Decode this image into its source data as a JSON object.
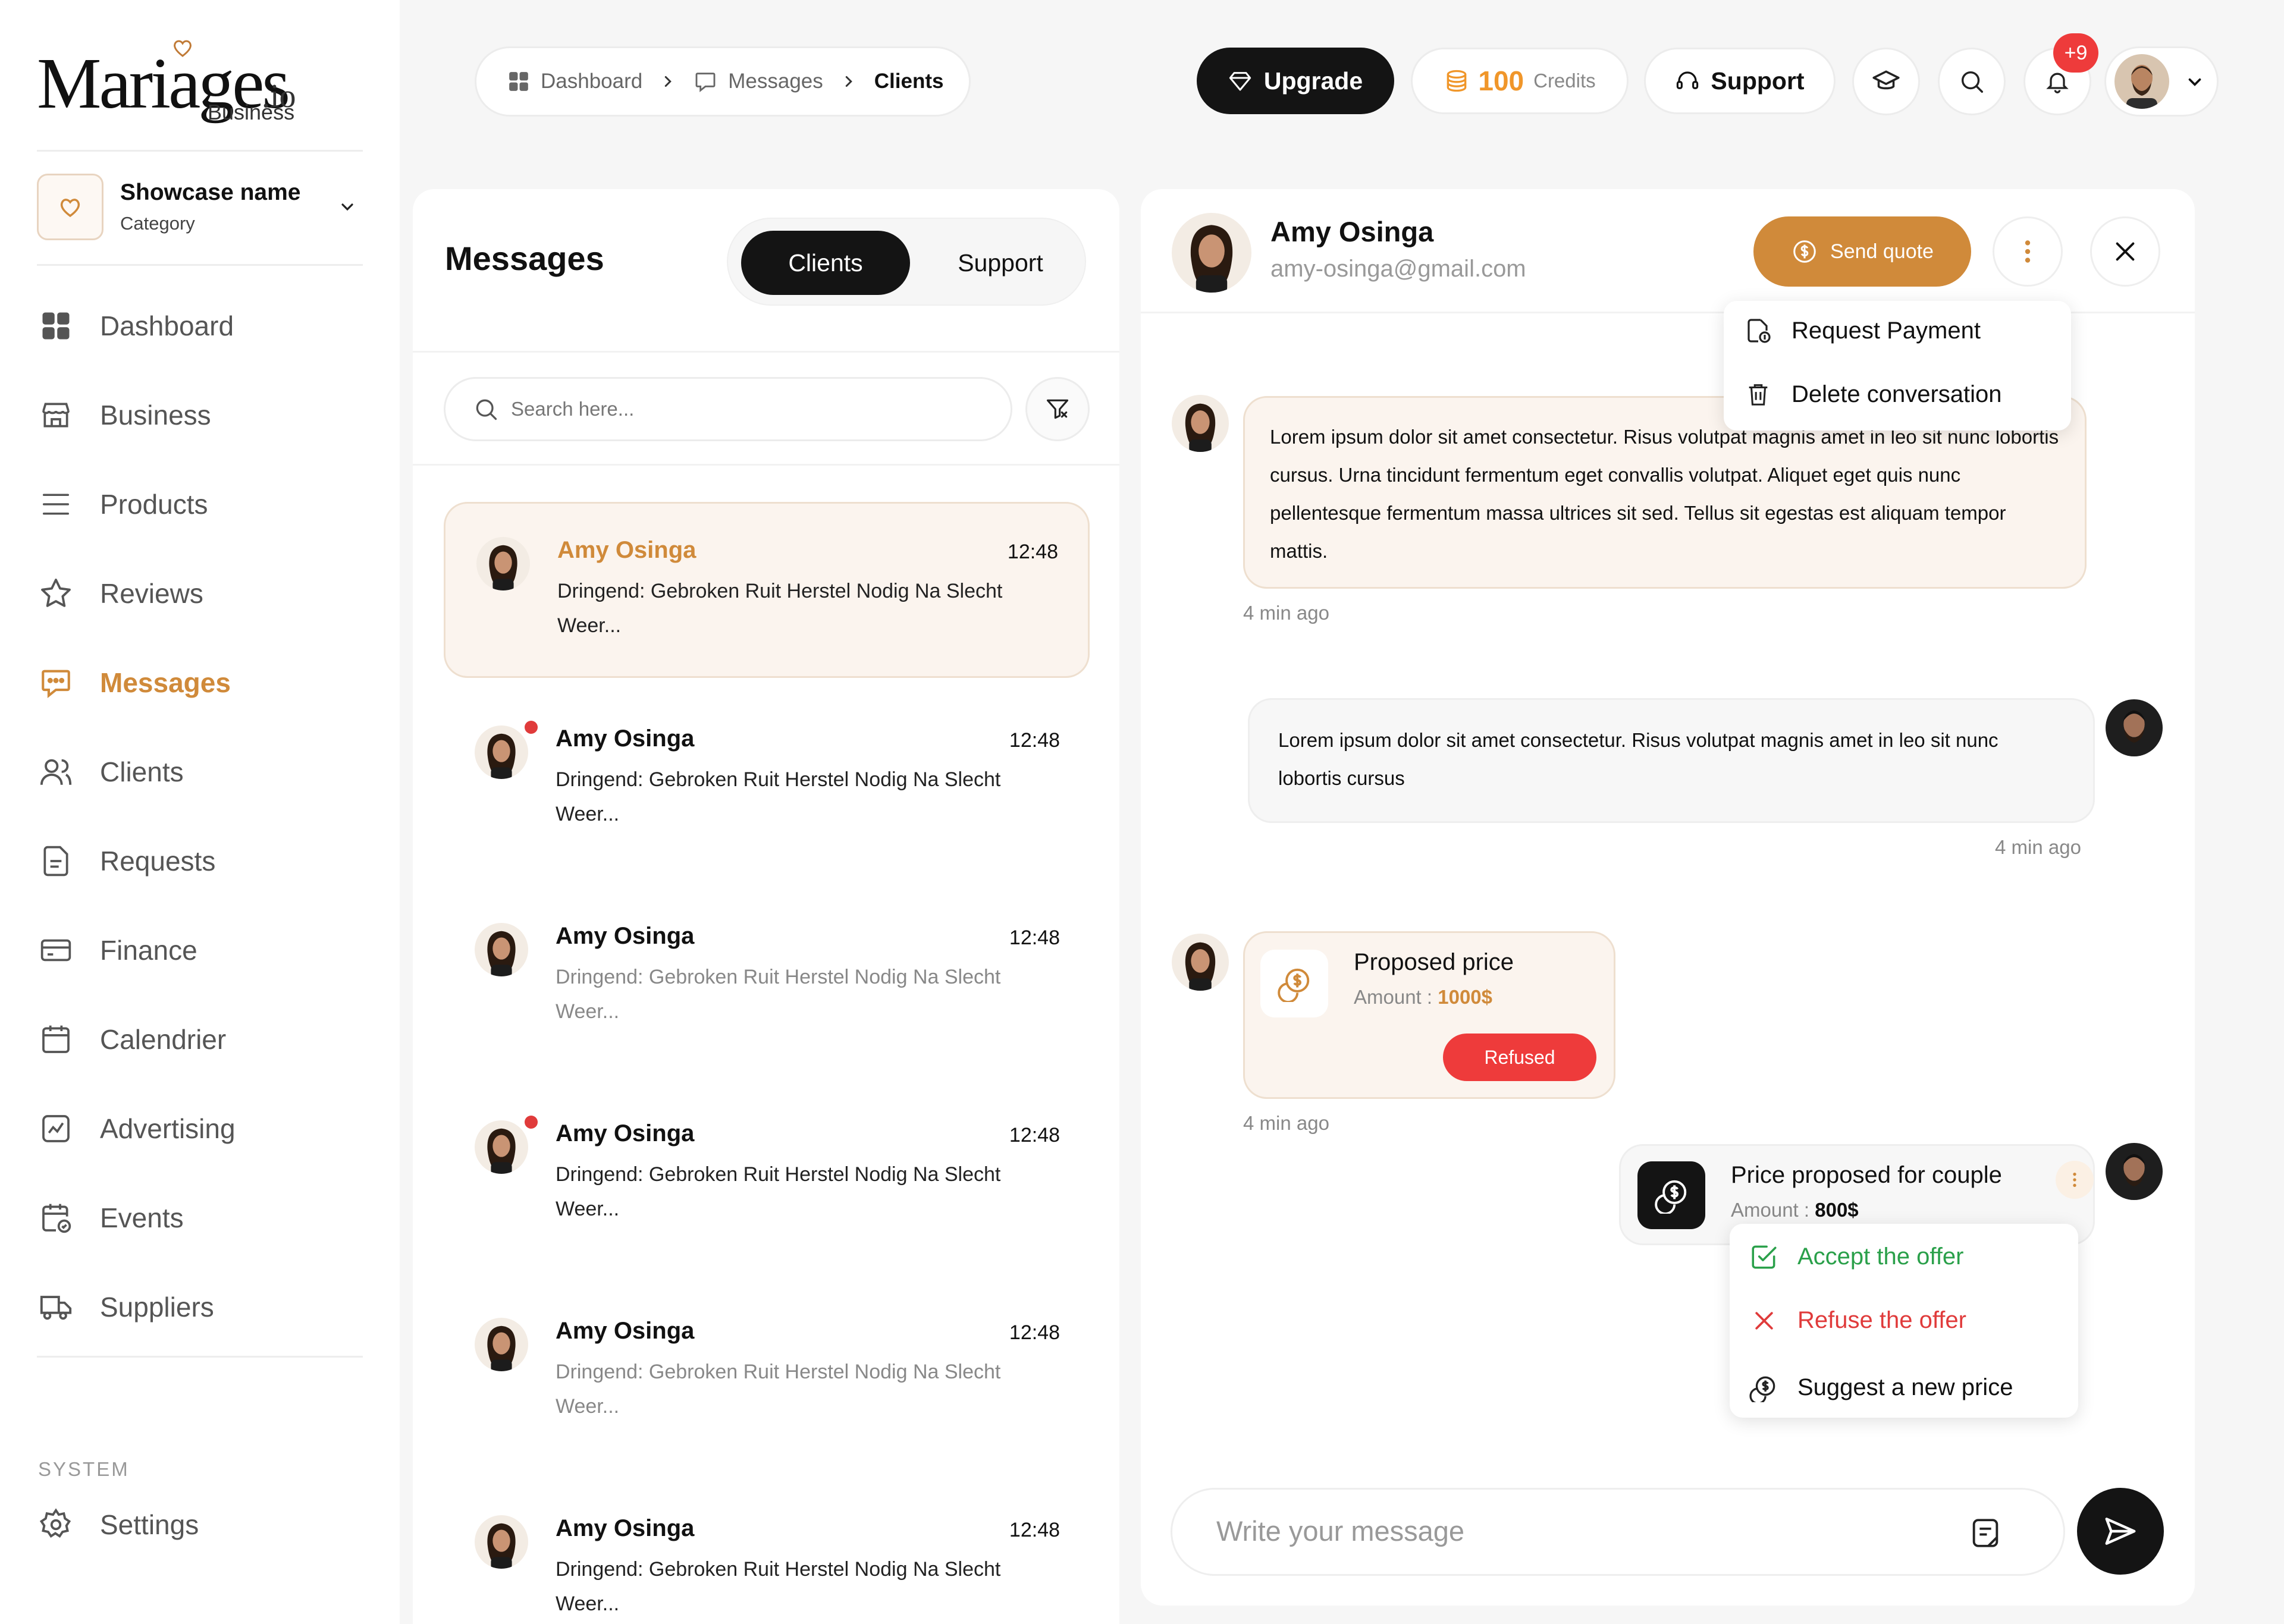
{
  "brand": {
    "name": "Mariages",
    "suffix": ".io",
    "sub": "Business"
  },
  "showcase": {
    "name": "Showcase name",
    "category": "Category"
  },
  "nav": {
    "items": [
      {
        "label": "Dashboard",
        "icon": "dashboard-icon"
      },
      {
        "label": "Business",
        "icon": "store-icon"
      },
      {
        "label": "Products",
        "icon": "menu-lines-icon"
      },
      {
        "label": "Reviews",
        "icon": "star-icon"
      },
      {
        "label": "Messages",
        "icon": "chat-icon",
        "active": true
      },
      {
        "label": "Clients",
        "icon": "users-icon"
      },
      {
        "label": "Requests",
        "icon": "document-icon"
      },
      {
        "label": "Finance",
        "icon": "card-icon"
      },
      {
        "label": "Calendrier",
        "icon": "calendar-icon"
      },
      {
        "label": "Advertising",
        "icon": "chart-icon"
      },
      {
        "label": "Events",
        "icon": "calendar-check-icon"
      },
      {
        "label": "Suppliers",
        "icon": "truck-icon"
      }
    ],
    "system_label": "SYSTEM",
    "settings_label": "Settings"
  },
  "breadcrumb": {
    "items": [
      "Dashboard",
      "Messages",
      "Clients"
    ]
  },
  "topbar": {
    "upgrade": "Upgrade",
    "credits_value": "100",
    "credits_label": "Credits",
    "support": "Support",
    "notifications_badge": "+9"
  },
  "messages": {
    "title": "Messages",
    "tabs": [
      "Clients",
      "Support"
    ],
    "active_tab": "Clients",
    "search_placeholder": "Search here...",
    "conversations": [
      {
        "name": "Amy Osinga",
        "time": "12:48",
        "preview": "Dringend: Gebroken Ruit Herstel Nodig Na Slecht Weer...",
        "active": true,
        "unread": false,
        "muted": false
      },
      {
        "name": "Amy Osinga",
        "time": "12:48",
        "preview": "Dringend: Gebroken Ruit Herstel Nodig Na Slecht Weer...",
        "active": false,
        "unread": true,
        "muted": false
      },
      {
        "name": "Amy Osinga",
        "time": "12:48",
        "preview": "Dringend: Gebroken Ruit Herstel Nodig Na Slecht Weer...",
        "active": false,
        "unread": false,
        "muted": true
      },
      {
        "name": "Amy Osinga",
        "time": "12:48",
        "preview": "Dringend: Gebroken Ruit Herstel Nodig Na Slecht Weer...",
        "active": false,
        "unread": true,
        "muted": false
      },
      {
        "name": "Amy Osinga",
        "time": "12:48",
        "preview": "Dringend: Gebroken Ruit Herstel Nodig Na Slecht Weer...",
        "active": false,
        "unread": false,
        "muted": true
      },
      {
        "name": "Amy Osinga",
        "time": "12:48",
        "preview": "Dringend: Gebroken Ruit Herstel Nodig Na Slecht Weer...",
        "active": false,
        "unread": false,
        "muted": false
      }
    ]
  },
  "chat": {
    "contact_name": "Amy Osinga",
    "contact_email": "amy-osinga@gmail.com",
    "send_quote": "Send quote",
    "more_menu": [
      "Request Payment",
      "Delete conversation"
    ],
    "incoming_1": "Lorem ipsum dolor sit amet consectetur. Risus volutpat magnis amet in leo sit nunc lobortis cursus. Urna tincidunt fermentum eget convallis volutpat. Aliquet eget quis nunc pellentesque fermentum massa ultrices sit sed. Tellus sit egestas est aliquam tempor mattis.",
    "incoming_1_time": "4 min ago",
    "outgoing_1": "Lorem ipsum dolor sit amet consectetur. Risus volutpat magnis amet in leo sit nunc lobortis cursus",
    "outgoing_1_time": "4 min ago",
    "offer_in": {
      "title": "Proposed price",
      "amount_label": "Amount : ",
      "amount": "1000$",
      "status": "Refused",
      "time": "4 min ago"
    },
    "offer_out": {
      "title": "Price proposed for couple",
      "amount_label": "Amount : ",
      "amount": "800$"
    },
    "offer_menu": [
      "Accept the offer",
      "Refuse the offer",
      "Suggest a new price"
    ],
    "composer_placeholder": "Write your message"
  },
  "colors": {
    "accent": "#d08a3a",
    "dark": "#141414",
    "danger": "#ee3b3b",
    "success": "#2aa04a"
  }
}
